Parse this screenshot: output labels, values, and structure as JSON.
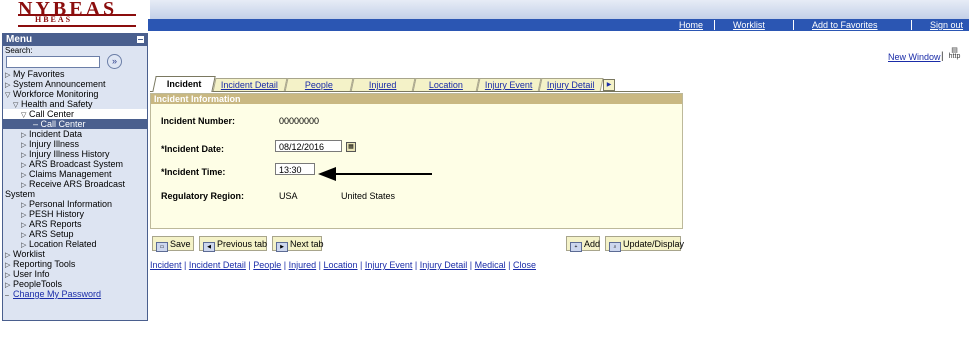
{
  "logo": {
    "title": "NYBEAS",
    "subtitle": "HBEAS"
  },
  "header_nav": [
    "Home",
    "Worklist",
    "Add to Favorites",
    "Sign out"
  ],
  "menu": {
    "title": "Menu",
    "search_label": "Search:",
    "search_value": "",
    "items": [
      {
        "label": "My Favorites",
        "level": 0,
        "arrow": "▷"
      },
      {
        "label": "System Announcement",
        "level": 0,
        "arrow": "▷"
      },
      {
        "label": "Workforce Monitoring",
        "level": 0,
        "arrow": "▽"
      },
      {
        "label": "Health and Safety",
        "level": 1,
        "arrow": "▽"
      },
      {
        "label": "Call Center",
        "level": 2,
        "arrow": "▽"
      },
      {
        "label": "– Call Center",
        "level": 3,
        "arrow": ""
      },
      {
        "label": "Incident Data",
        "level": 2,
        "arrow": "▷"
      },
      {
        "label": "Injury Illness",
        "level": 2,
        "arrow": "▷"
      },
      {
        "label": "Injury Illness History",
        "level": 2,
        "arrow": "▷"
      },
      {
        "label": "ARS Broadcast System",
        "level": 2,
        "arrow": "▷"
      },
      {
        "label": "Claims Management",
        "level": 2,
        "arrow": "▷"
      },
      {
        "label": "Receive ARS Broadcast",
        "level": 2,
        "arrow": "▷"
      },
      {
        "label": "System",
        "level": 0,
        "arrow": ""
      },
      {
        "label": "Personal Information",
        "level": 2,
        "arrow": "▷"
      },
      {
        "label": "PESH History",
        "level": 2,
        "arrow": "▷"
      },
      {
        "label": "ARS Reports",
        "level": 2,
        "arrow": "▷"
      },
      {
        "label": "ARS Setup",
        "level": 2,
        "arrow": "▷"
      },
      {
        "label": "Location Related",
        "level": 2,
        "arrow": "▷"
      },
      {
        "label": "Worklist",
        "level": 0,
        "arrow": "▷"
      },
      {
        "label": "Reporting Tools",
        "level": 0,
        "arrow": "▷"
      },
      {
        "label": "User Info",
        "level": 0,
        "arrow": "▷"
      },
      {
        "label": "PeopleTools",
        "level": 0,
        "arrow": "▷"
      },
      {
        "label": "Change My Password",
        "level": 0,
        "arrow": "–"
      }
    ]
  },
  "new_window": "New Window",
  "tabs": [
    "Incident",
    "Incident Detail",
    "People",
    "Injured",
    "Location",
    "Injury Event",
    "Injury Detail"
  ],
  "panel": {
    "title": "Incident Information",
    "incident_number_label": "Incident Number:",
    "incident_number": "00000000",
    "incident_date_label": "*Incident Date:",
    "incident_date": "08/12/2016",
    "incident_time_label": "*Incident Time:",
    "incident_time": "13:30",
    "region_label": "Regulatory Region:",
    "region_code": "USA",
    "region_name": "United States"
  },
  "buttons": {
    "save": "Save",
    "previous_tab": "Previous tab",
    "next_tab": "Next tab",
    "add": "Add",
    "update_display": "Update/Display"
  },
  "bottom_links": [
    "Incident",
    "Incident Detail",
    "People",
    "Injured",
    "Location",
    "Injury Event",
    "Injury Detail",
    "Medical",
    "Close"
  ],
  "colors": {
    "nav_blue": "#2b56b3",
    "menu_blue": "#4a5f8e",
    "panel_head": "#c9b882",
    "tab_bg": "#f4f2c8",
    "logo_red": "#8b0d0d"
  }
}
